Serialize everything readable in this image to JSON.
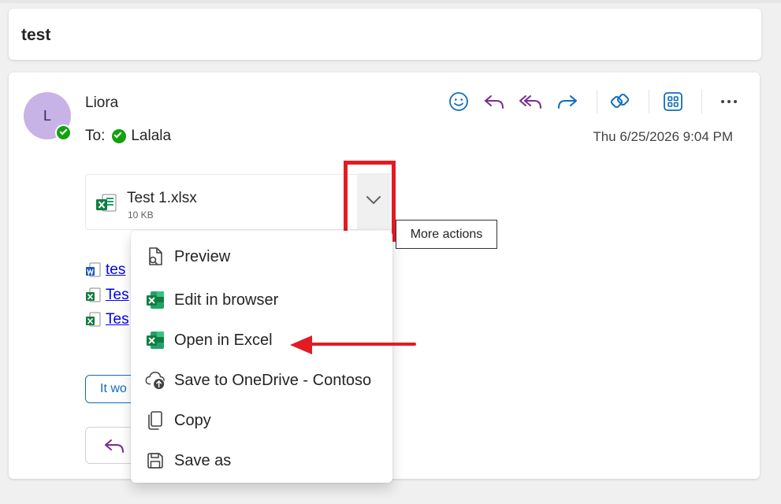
{
  "subject": "test",
  "sender": {
    "initial": "L",
    "name": "Liora",
    "to_label": "To:",
    "recipient": "Lalala",
    "date": "Thu 6/25/2026 9:04 PM"
  },
  "toolbar": {
    "icons": [
      "emoji-icon",
      "reply-icon",
      "reply-all-icon",
      "forward-icon",
      "loop-icon",
      "apps-icon",
      "more-icon"
    ]
  },
  "attachment": {
    "name": "Test 1.xlsx",
    "size": "10 KB",
    "tooltip": "More actions"
  },
  "links": [
    {
      "icon": "word-file-icon",
      "text": "tes"
    },
    {
      "icon": "excel-file-icon",
      "text": "Tes"
    },
    {
      "icon": "excel-file-icon",
      "text": "Tes"
    }
  ],
  "suggested_reply": "It wo",
  "menu": {
    "items": [
      {
        "label": "Preview",
        "icon": "preview-icon"
      },
      {
        "label": "Edit in browser",
        "icon": "excel-icon"
      },
      {
        "label": "Open in Excel",
        "icon": "excel-icon"
      },
      {
        "label": "Save to OneDrive - Contoso",
        "icon": "cloud-upload-icon"
      },
      {
        "label": "Copy",
        "icon": "copy-icon"
      },
      {
        "label": "Save as",
        "icon": "save-icon"
      }
    ]
  },
  "colors": {
    "annotation_red": "#e31b23",
    "link_blue": "#0000ee",
    "accent_blue": "#0f6cbd",
    "reply_purple": "#7a2b8f",
    "excel_green": "#107c41",
    "presence_green": "#13a10e"
  }
}
